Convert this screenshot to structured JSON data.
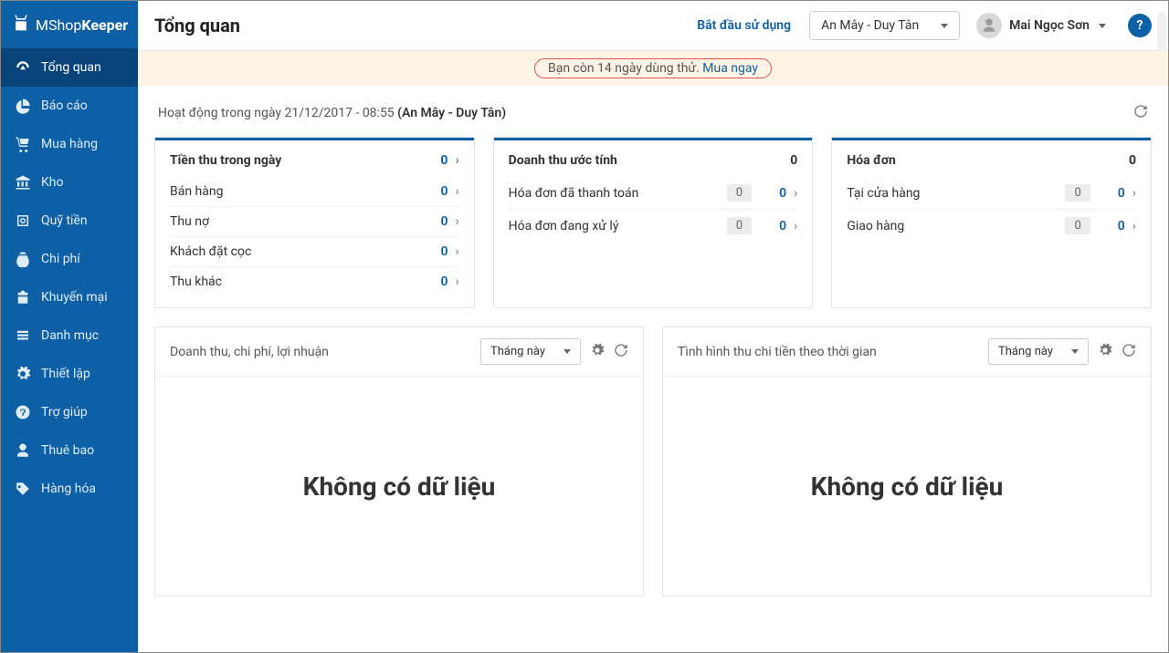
{
  "brand": {
    "prefix": "MShop",
    "suffix": "Keeper"
  },
  "sidebar": [
    {
      "id": "overview",
      "label": "Tổng quan",
      "icon": "gauge",
      "active": true
    },
    {
      "id": "reports",
      "label": "Báo cáo",
      "icon": "pie"
    },
    {
      "id": "purchase",
      "label": "Mua hàng",
      "icon": "cart"
    },
    {
      "id": "warehouse",
      "label": "Kho",
      "icon": "bank"
    },
    {
      "id": "fund",
      "label": "Quỹ tiền",
      "icon": "safe"
    },
    {
      "id": "expense",
      "label": "Chi phí",
      "icon": "moneybag"
    },
    {
      "id": "promotion",
      "label": "Khuyến mại",
      "icon": "gift"
    },
    {
      "id": "catalog",
      "label": "Danh mục",
      "icon": "list"
    },
    {
      "id": "settings",
      "label": "Thiết lập",
      "icon": "gear"
    },
    {
      "id": "help",
      "label": "Trợ giúp",
      "icon": "help"
    },
    {
      "id": "subscription",
      "label": "Thuê bao",
      "icon": "user"
    },
    {
      "id": "goods",
      "label": "Hàng hóa",
      "icon": "tag"
    }
  ],
  "header": {
    "title": "Tổng quan",
    "start_link": "Bắt đầu sử dụng",
    "store": "An Mây - Duy Tân",
    "user": "Mai Ngọc Sơn"
  },
  "trial": {
    "text": "Bạn còn 14 ngày dùng thử. ",
    "link": "Mua ngay"
  },
  "activity": {
    "prefix": "Hoạt động trong ngày ",
    "date": "21/12/2017 - 08:55",
    "store": "(An Mây - Duy Tân)"
  },
  "cards": {
    "income": {
      "title": "Tiền thu trong ngày",
      "value": "0",
      "rows": [
        {
          "label": "Bán hàng",
          "value": "0"
        },
        {
          "label": "Thu nợ",
          "value": "0"
        },
        {
          "label": "Khách đặt cọc",
          "value": "0"
        },
        {
          "label": "Thu khác",
          "value": "0"
        }
      ]
    },
    "revenue": {
      "title": "Doanh thu ước tính",
      "value": "0",
      "rows": [
        {
          "label": "Hóa đơn đã thanh toán",
          "badge": "0",
          "value": "0"
        },
        {
          "label": "Hóa đơn đang xử lý",
          "badge": "0",
          "value": "0"
        }
      ]
    },
    "invoice": {
      "title": "Hóa đơn",
      "value": "0",
      "rows": [
        {
          "label": "Tại cửa hàng",
          "badge": "0",
          "value": "0"
        },
        {
          "label": "Giao hàng",
          "badge": "0",
          "value": "0"
        }
      ]
    }
  },
  "panels": {
    "left": {
      "title": "Doanh thu, chi phí, lợi nhuận",
      "period": "Tháng này",
      "empty": "Không có dữ liệu"
    },
    "right": {
      "title": "Tình hình thu chi tiền theo thời gian",
      "period": "Tháng này",
      "empty": "Không có dữ liệu"
    }
  }
}
